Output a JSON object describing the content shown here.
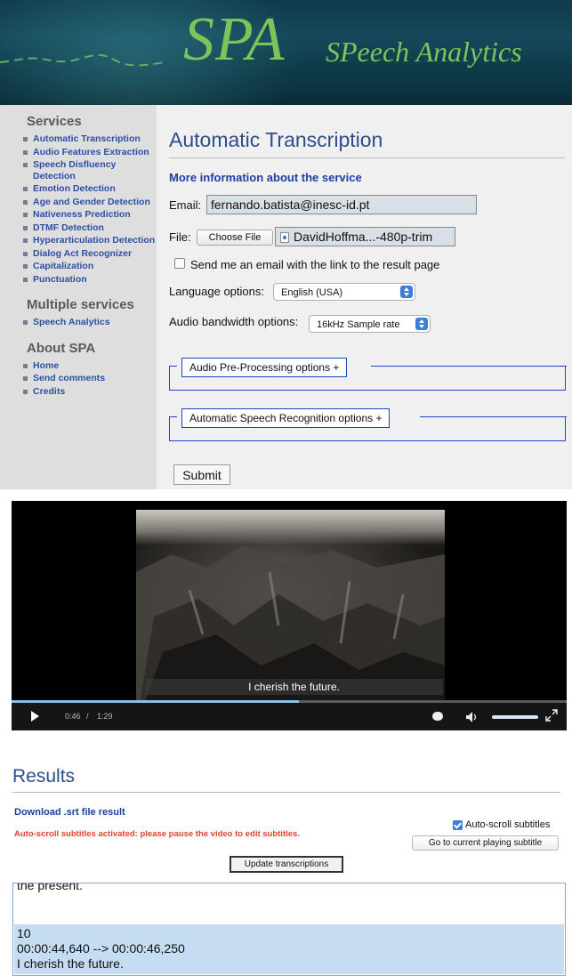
{
  "header": {
    "logo": "SPA",
    "subtitle": "SPeech Analytics"
  },
  "sidebar": {
    "sections": [
      {
        "heading": "Services",
        "items": [
          {
            "label": "Automatic Transcription"
          },
          {
            "label": "Audio Features Extraction"
          },
          {
            "label": "Speech Disfluency Detection"
          },
          {
            "label": "Emotion Detection"
          },
          {
            "label": "Age and Gender Detection"
          },
          {
            "label": "Nativeness Prediction"
          },
          {
            "label": "DTMF Detection"
          },
          {
            "label": "Hyperarticulation Detection"
          },
          {
            "label": "Dialog Act Recognizer"
          },
          {
            "label": "Capitalization"
          },
          {
            "label": "Punctuation"
          }
        ]
      },
      {
        "heading": "Multiple services",
        "items": [
          {
            "label": "Speech Analytics"
          }
        ]
      },
      {
        "heading": "About SPA",
        "items": [
          {
            "label": "Home"
          },
          {
            "label": "Send comments"
          },
          {
            "label": "Credits"
          }
        ]
      }
    ]
  },
  "form": {
    "title": "Automatic Transcription",
    "more_info_link": "More information about the service",
    "email_label": "Email:",
    "email_value": "fernando.batista@inesc-id.pt",
    "file_label": "File:",
    "choose_file_label": "Choose File",
    "file_name": "DavidHoffma...-480p-trim",
    "send_email_label": "Send me an email with the link to the result page",
    "send_email_checked": false,
    "language_label": "Language options:",
    "language_value": "English (USA)",
    "bandwidth_label": "Audio bandwidth options:",
    "bandwidth_value": "16kHz Sample rate",
    "preprocessing_legend": "Audio Pre-Processing options +",
    "asr_legend": "Automatic Speech Recognition options +",
    "submit_label": "Submit"
  },
  "video": {
    "subtitle": "I cherish the future.",
    "current_time": "0:46",
    "separator": "/",
    "duration": "1:29",
    "progress": 0.517,
    "volume": 0.9
  },
  "results": {
    "title": "Results",
    "download_link": "Download .srt file result",
    "autoscroll_message": "Auto-scroll subtitles activated: please pause the video to edit subtitles.",
    "autoscroll_label": "Auto-scroll subtitles",
    "autoscroll_checked": true,
    "goto_button": "Go to current playing subtitle",
    "update_button": "Update transcriptions",
    "previous_text": "the present.",
    "current_subtitle": {
      "index": "10",
      "timing": "00:00:44,640 --> 00:00:46,250",
      "text": "I cherish the future."
    }
  },
  "colors": {
    "title_blue": "#2e4d8c",
    "link_blue": "#2c4fa6",
    "logo_green": "#7cc35a",
    "warning_red": "#e0432b",
    "highlight": "#c6dcf3"
  }
}
